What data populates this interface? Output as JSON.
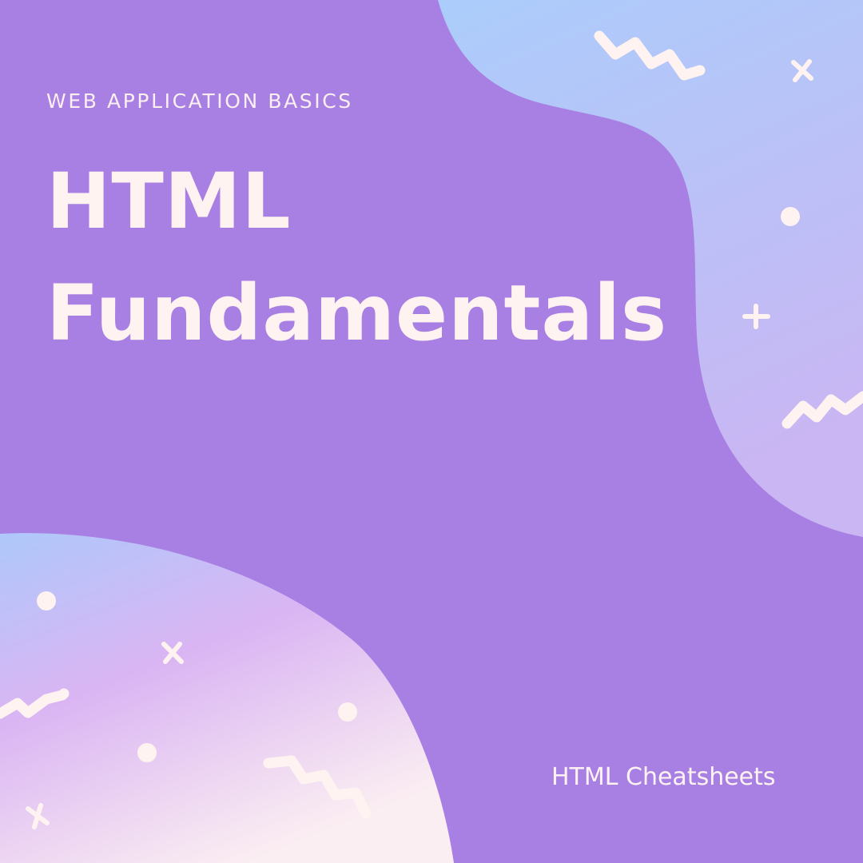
{
  "eyebrow": "WEB APPLICATION BASICS",
  "title": {
    "line1": "HTML",
    "line2": "Fundamentals"
  },
  "footer": "HTML Cheatsheets",
  "colors": {
    "background": "#a87fe3",
    "text": "#fff3f1",
    "blob_top_start": "#abcdfb",
    "blob_top_end": "#c7b6f4",
    "blob_bottom_start": "#aec8fb",
    "blob_bottom_mid": "#dab5f3",
    "blob_bottom_end": "#fbeef2",
    "decor": "#fff3f1"
  },
  "decorations": [
    "zigzag-icon",
    "cross-icon",
    "dot-icon",
    "plus-icon"
  ]
}
